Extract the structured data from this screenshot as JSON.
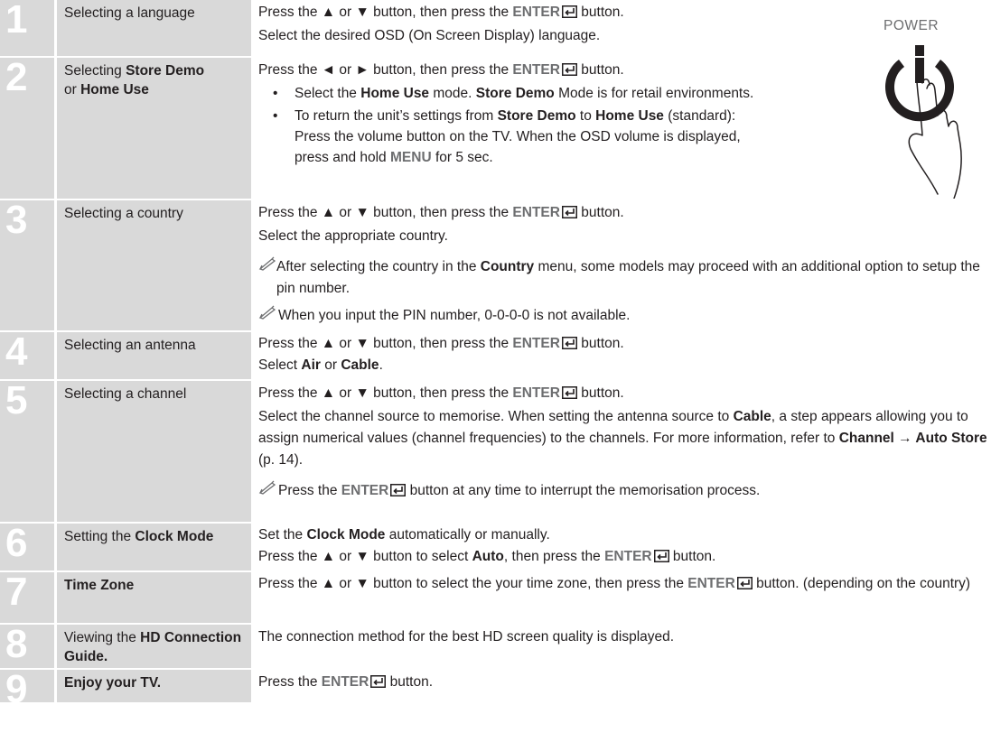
{
  "power": {
    "label": "POWER"
  },
  "steps": [
    {
      "num": "1",
      "label": "Selecting a language",
      "l1": {
        "a": "Press the ▲ or ▼ button, then press the ",
        "k": "ENTER",
        "b": " button."
      },
      "l2": "Select the desired OSD (On Screen Display) language."
    },
    {
      "num": "2",
      "label_a": "Selecting ",
      "label_b": "Store Demo",
      "label_c": " or ",
      "label_d": "Home Use",
      "l1": {
        "a": "Press the ◄ or ► button, then press the ",
        "k": "ENTER",
        "b": " button."
      },
      "bullet1": {
        "a": "Select the ",
        "b": "Home Use",
        "c": " mode. ",
        "d": "Store Demo",
        "e": " Mode is for retail environments."
      },
      "bullet2": {
        "a": "To return the unit’s settings from ",
        "b": "Store Demo",
        "c": " to ",
        "d": "Home Use",
        "e": " (standard): Press the volume button on the TV. When the OSD volume is displayed, press and hold ",
        "f": "MENU",
        "g": " for 5 sec."
      }
    },
    {
      "num": "3",
      "label": "Selecting a country",
      "l1": {
        "a": "Press the ▲ or ▼ button, then press the ",
        "k": "ENTER",
        "b": " button."
      },
      "l2": "Select the appropriate country.",
      "note1": {
        "a": "After selecting the country in the ",
        "b": "Country",
        "c": " menu, some models may proceed with an additional option to setup the pin number."
      },
      "note2": "When you input the PIN number, 0-0-0-0 is not available."
    },
    {
      "num": "4",
      "label": "Selecting an antenna",
      "l1": {
        "a": "Press the ▲ or ▼ button, then press the ",
        "k": "ENTER",
        "b": " button."
      },
      "l2": {
        "a": "Select ",
        "b": "Air",
        "c": " or ",
        "d": "Cable",
        "e": "."
      }
    },
    {
      "num": "5",
      "label": "Selecting a channel",
      "l1": {
        "a": "Press the ▲ or ▼ button, then press the ",
        "k": "ENTER",
        "b": " button."
      },
      "l2": {
        "a": "Select the channel source to memorise. When setting the antenna source to ",
        "b": "Cable",
        "c": ", a step appears allowing you to assign numerical values (channel frequencies) to the channels. For more information, refer to ",
        "d": "Channel → Auto Store",
        "e": " (p. 14)."
      },
      "note1": {
        "a": "Press the ",
        "k": "ENTER",
        "b": " button at any time to interrupt the memorisation process."
      }
    },
    {
      "num": "6",
      "label_a": "Setting the ",
      "label_b": "Clock Mode",
      "l1": {
        "a": "Set the ",
        "b": "Clock Mode",
        "c": " automatically or manually."
      },
      "l2": {
        "a": "Press the ▲ or ▼ button to select ",
        "b": "Auto",
        "c": ", then press the ",
        "k": "ENTER",
        "d": " button."
      }
    },
    {
      "num": "7",
      "label": "Time Zone",
      "l1": {
        "a": "Press the ▲ or ▼ button to select the your time zone, then press the ",
        "k": "ENTER",
        "b": " button. (depending on the country)"
      }
    },
    {
      "num": "8",
      "label_a": "Viewing the ",
      "label_b": "HD Connection Guide.",
      "l1": "The connection method for the best HD screen quality is displayed."
    },
    {
      "num": "9",
      "label": "Enjoy your TV.",
      "l1": {
        "a": "Press the ",
        "k": "ENTER",
        "b": " button."
      }
    }
  ]
}
